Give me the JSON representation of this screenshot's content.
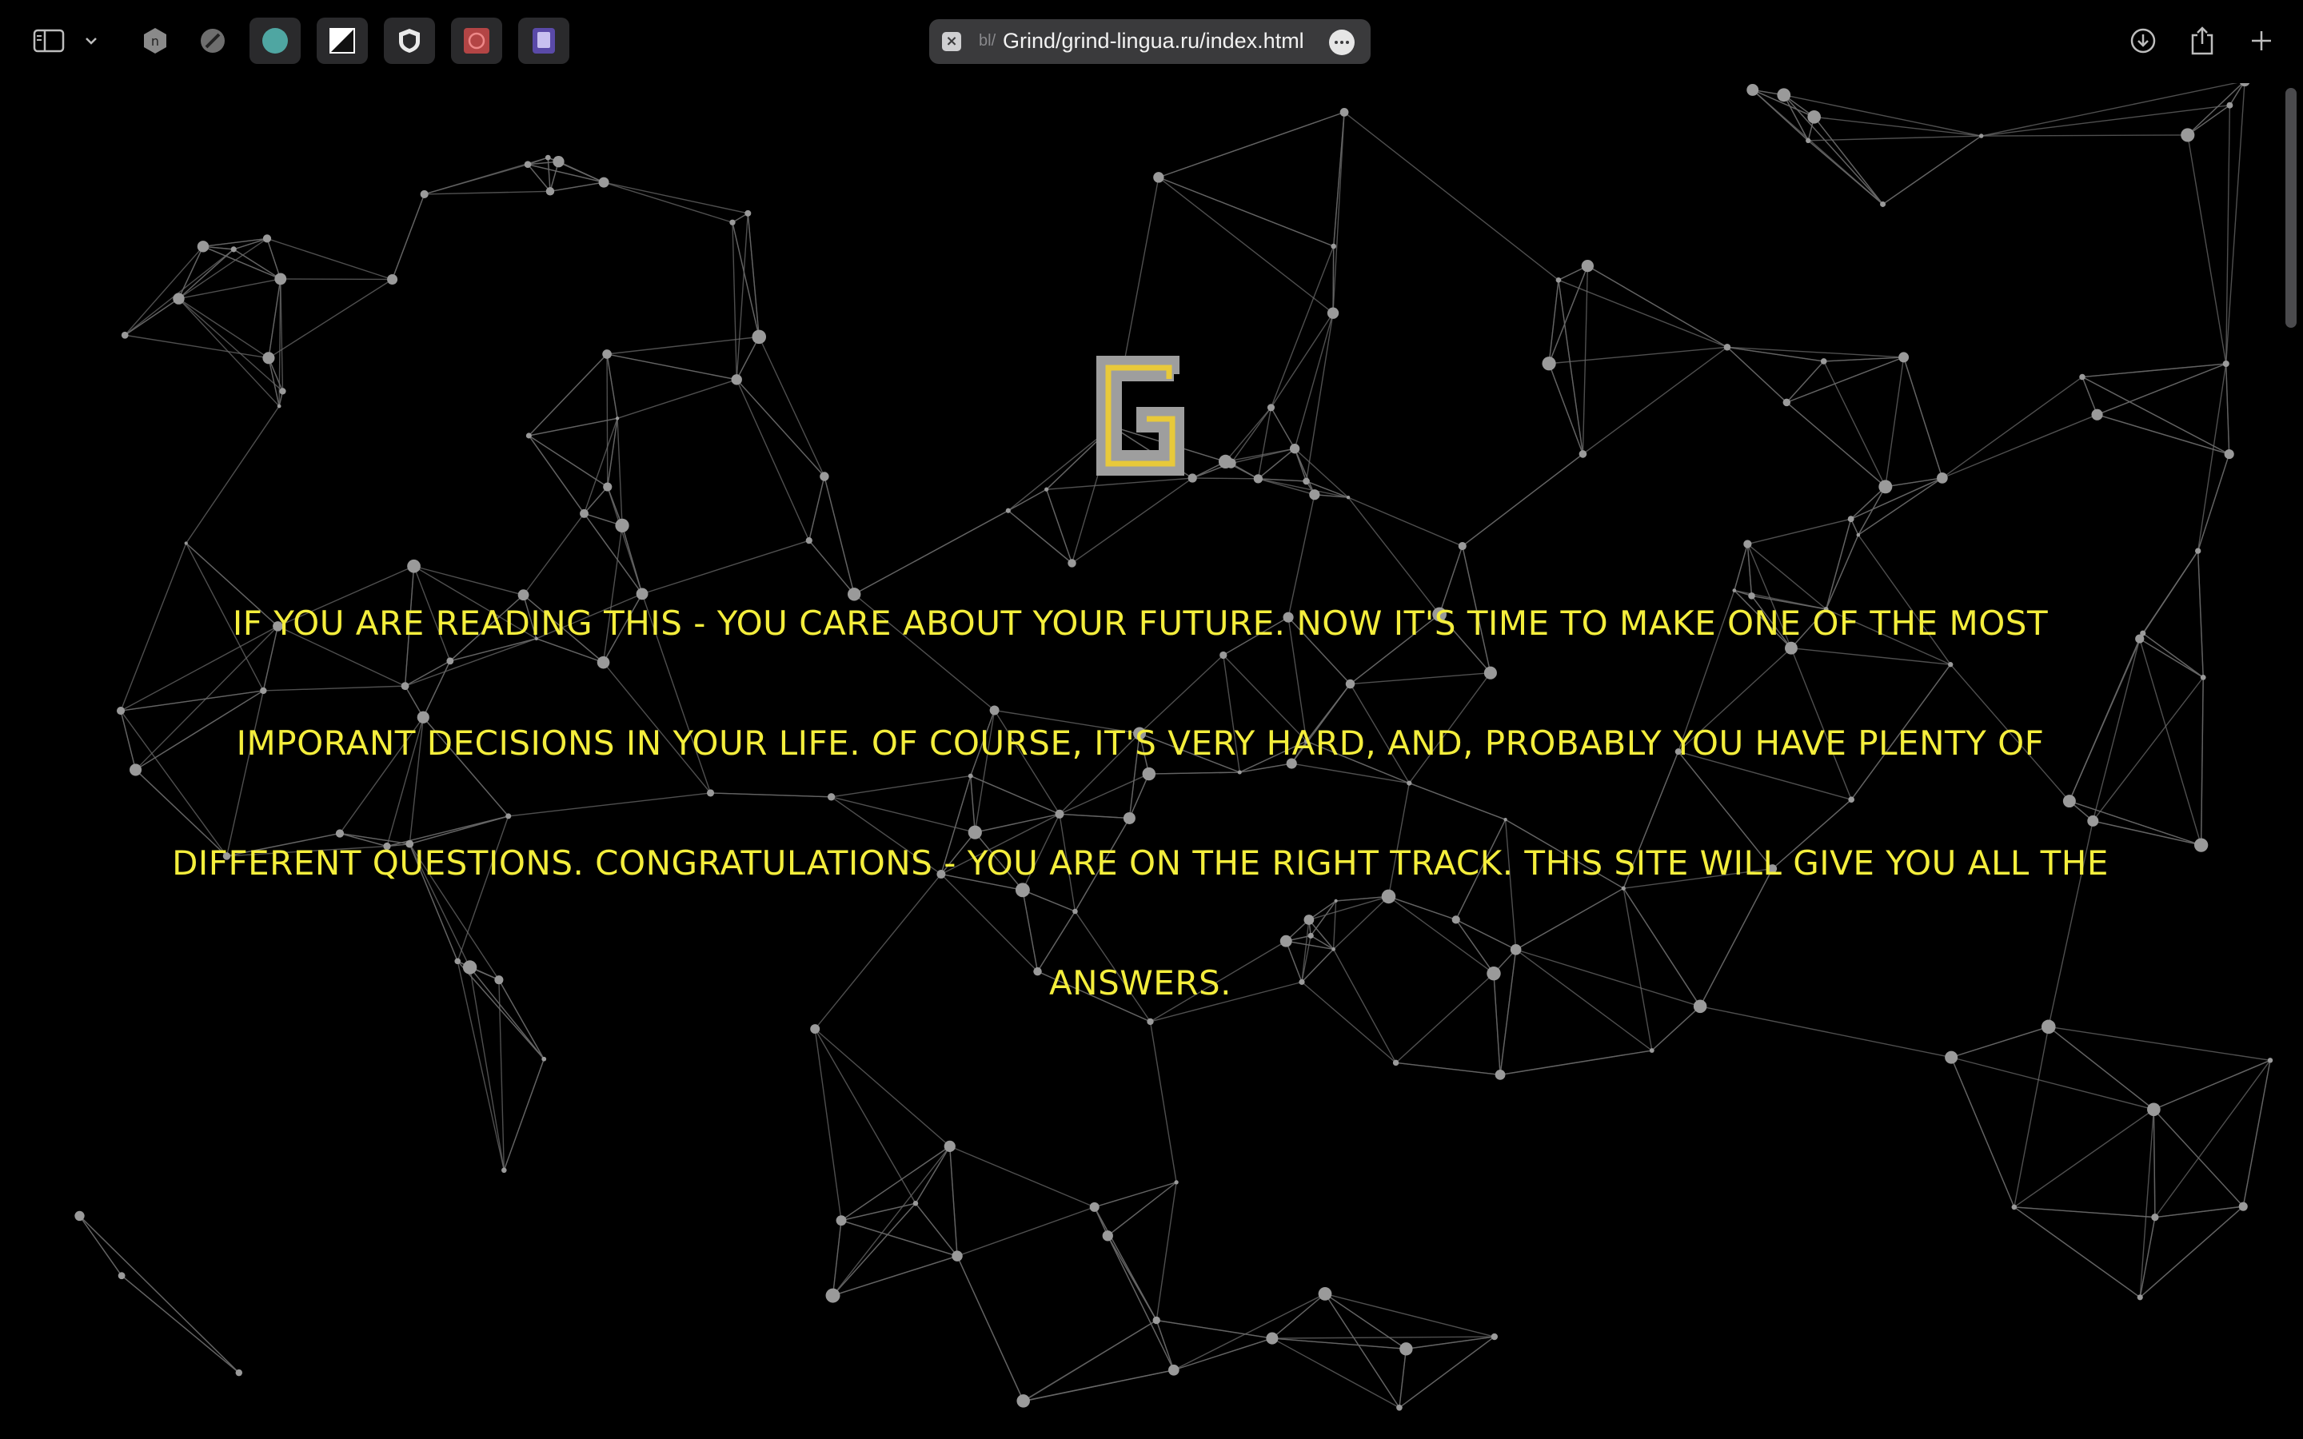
{
  "browser": {
    "address": {
      "prefix": "bl/",
      "url": "Grind/grind-lingua.ru/index.html"
    },
    "toolbar_icons": [
      "sidebar-icon",
      "chevron-down-icon",
      "extension-icon",
      "compass-icon",
      "circle-icon",
      "contrast-icon",
      "shield-icon",
      "chat-icon",
      "notes-icon",
      "download-icon",
      "share-icon",
      "plus-icon"
    ]
  },
  "page": {
    "logo_letter": "G",
    "hero_text": "IF YOU ARE READING THIS - YOU CARE ABOUT YOUR FUTURE. NOW IT'S TIME TO MAKE ONE OF THE MOST IMPORANT DECISIONS IN YOUR LIFE. OF COURSE, IT'S VERY HARD, AND, PROBABLY YOU HAVE PLENTY OF DIFFERENT QUESTIONS. CONGRATULATIONS - YOU ARE ON THE RIGHT TRACK. THIS SITE WILL GIVE YOU ALL THE ANSWERS."
  },
  "colors": {
    "background": "#000000",
    "hero_text": "#f4ee3c",
    "network_lines": "#6a6a6a",
    "network_nodes": "#9a9a9a",
    "logo_gold": "#e8c93a",
    "logo_silver": "#bdbdbd"
  }
}
